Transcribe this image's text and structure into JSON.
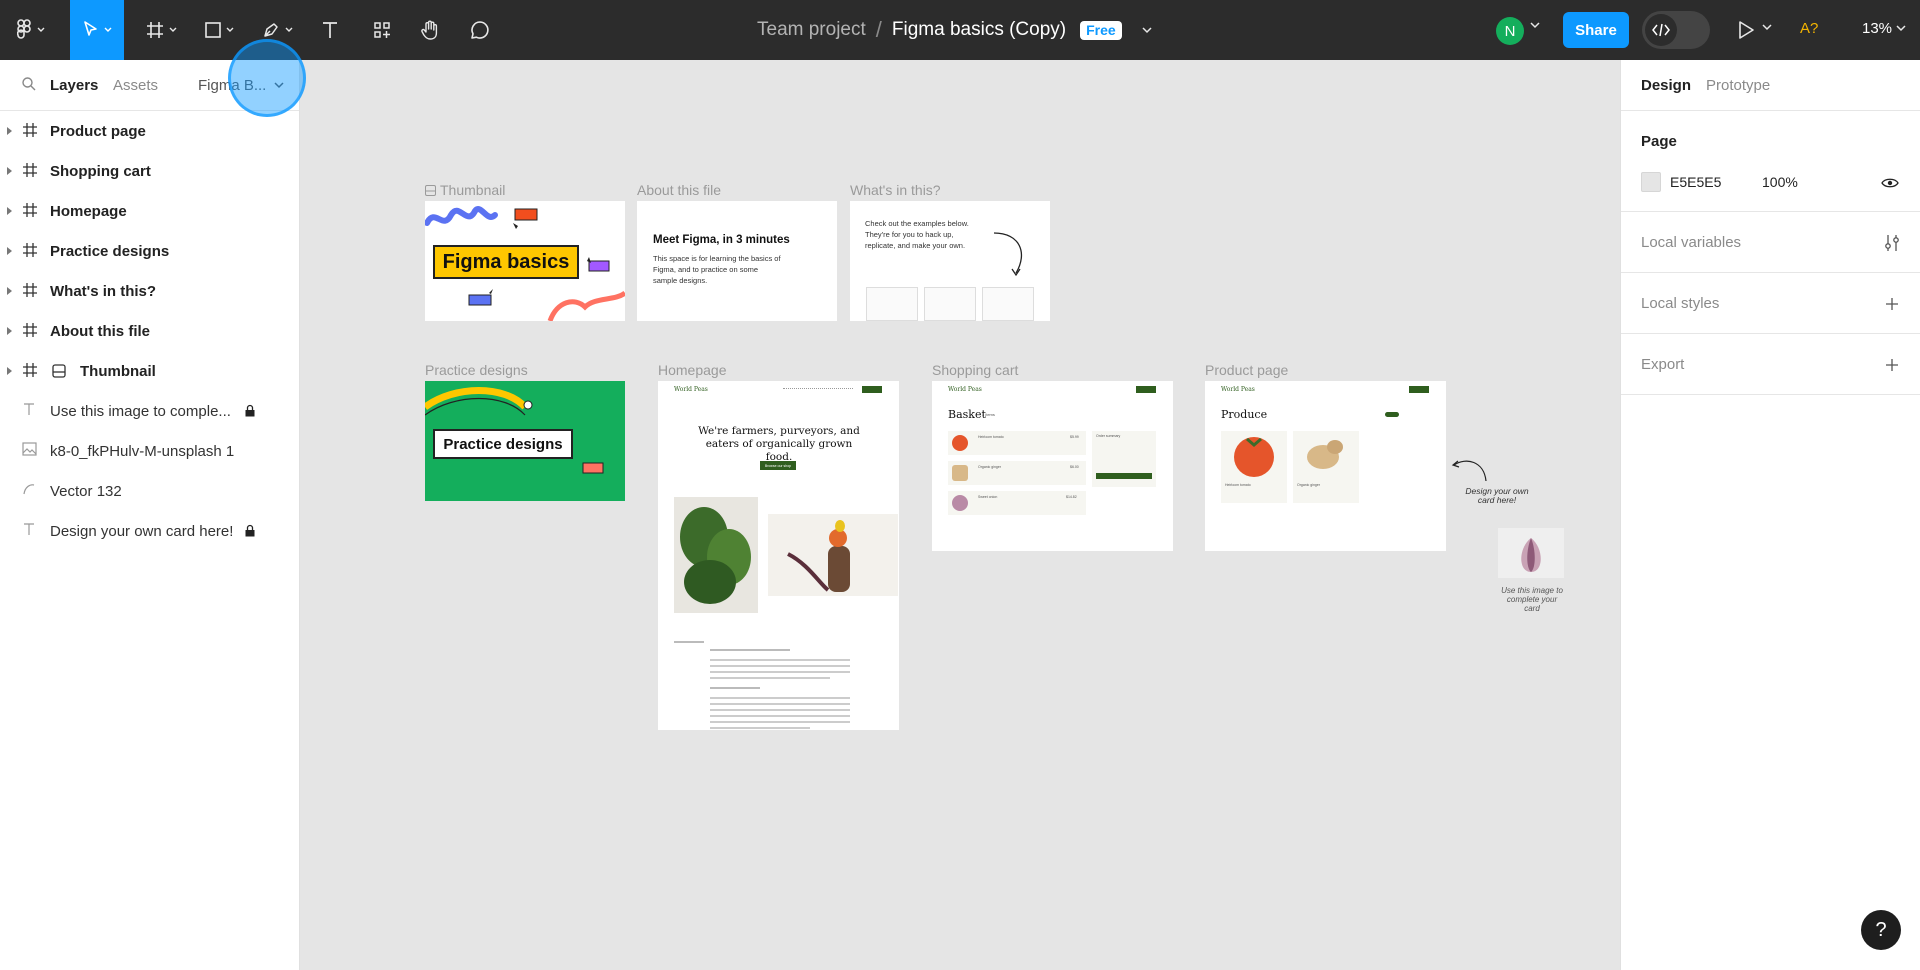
{
  "toolbar": {
    "title_team": "Team project",
    "title_sep": "/",
    "title_file": "Figma basics (Copy)",
    "plan_badge": "Free",
    "avatar_initial": "N",
    "share_label": "Share",
    "a11y_label": "A?",
    "zoom_label": "13%",
    "accent_color": "#0d99ff"
  },
  "left_panel": {
    "tabs": {
      "layers": "Layers",
      "assets": "Assets",
      "page": "Figma B..."
    },
    "layers": [
      {
        "name": "Product page",
        "kind": "frame",
        "icon": "frame-icon"
      },
      {
        "name": "Shopping cart",
        "kind": "frame",
        "icon": "frame-icon"
      },
      {
        "name": "Homepage",
        "kind": "frame",
        "icon": "frame-icon"
      },
      {
        "name": "Practice designs",
        "kind": "frame",
        "icon": "frame-icon"
      },
      {
        "name": "What's in this?",
        "kind": "frame",
        "icon": "frame-icon"
      },
      {
        "name": "About this file",
        "kind": "frame",
        "icon": "frame-icon"
      },
      {
        "name": "Thumbnail",
        "kind": "frame",
        "icon": "frame-icon"
      },
      {
        "name": "Use this image to comple...",
        "kind": "text",
        "icon": "text-icon",
        "locked": true
      },
      {
        "name": "k8-0_fkPHulv-M-unsplash 1",
        "kind": "image",
        "icon": "image-icon"
      },
      {
        "name": "Vector 132",
        "kind": "vector",
        "icon": "vector-icon"
      },
      {
        "name": "Design your own card here!",
        "kind": "text",
        "icon": "text-icon",
        "locked": true
      }
    ]
  },
  "right_panel": {
    "tabs": {
      "design": "Design",
      "prototype": "Prototype"
    },
    "page_title": "Page",
    "page_color": "E5E5E5",
    "page_opacity": "100%",
    "local_variables": "Local variables",
    "local_styles": "Local styles",
    "export": "Export"
  },
  "canvas": {
    "frame_labels": {
      "thumbnail": "Thumbnail",
      "about": "About this file",
      "whats_in": "What's in this?",
      "practice": "Practice designs",
      "homepage": "Homepage",
      "cart": "Shopping cart",
      "product": "Product page"
    },
    "thumbnail_text": "Figma basics",
    "about_heading": "Meet Figma, in 3 minutes",
    "about_body": "This space is for learning the basics of Figma, and to practice on some sample designs.",
    "whats_in_body": "Check out the examples below. They're for you to hack up, replicate, and make your own.",
    "practice_text": "Practice designs",
    "homepage_brand": "World Peas",
    "homepage_headline": "We're farmers, purveyors, and eaters of organically grown food.",
    "homepage_cta": "Browse our shop",
    "cart_heading": "Basket",
    "cart_count": "3 items",
    "cart_summary": "Order summary",
    "cart_items": [
      {
        "name": "Heirloom tomato",
        "price": "$5.99"
      },
      {
        "name": "Organic ginger",
        "price": "$6.00"
      },
      {
        "name": "Sweet onion",
        "price": "$14.82"
      }
    ],
    "product_heading": "Produce",
    "product_items": [
      "Heirloom tomato",
      "Organic ginger"
    ],
    "note_card": "Design your own card here!",
    "note_image": "Use this image to complete your card",
    "colors": {
      "thumb_yellow": "#ffc700",
      "practice_green": "#14ae5c",
      "shop_green": "#2f5e1e"
    }
  },
  "help_label": "?"
}
